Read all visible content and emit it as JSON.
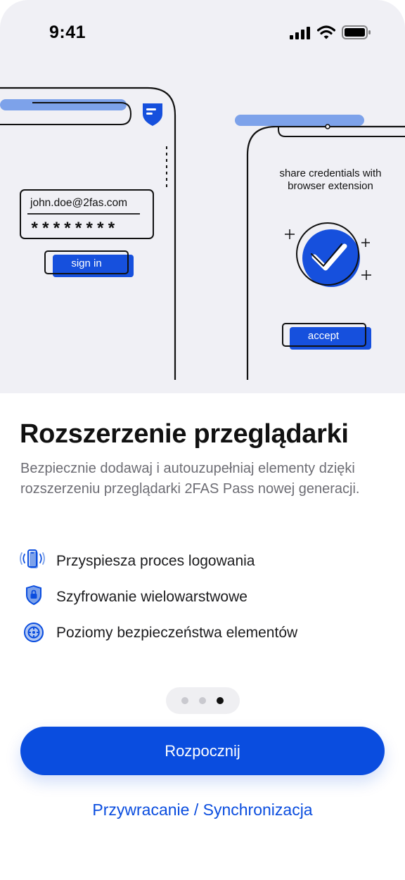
{
  "status_bar": {
    "time": "9:41"
  },
  "illustration": {
    "left_phone": {
      "email": "john.doe@2fas.com",
      "password_mask": "********",
      "button_label": "sign in"
    },
    "right_phone": {
      "caption_line1": "share credentials with",
      "caption_line2": "browser extension",
      "button_label": "accept"
    }
  },
  "content": {
    "title": "Rozszerzenie przeglądarki",
    "description": "Bezpiecznie dodawaj i autouzupełniaj elementy dzięki rozszerzeniu przeglądarki 2FAS Pass nowej generacji.",
    "features": [
      {
        "icon": "phone-vibrate-icon",
        "label": "Przyspiesza proces logowania"
      },
      {
        "icon": "shield-lock-icon",
        "label": "Szyfrowanie wielowarstwowe"
      },
      {
        "icon": "security-levels-icon",
        "label": "Poziomy bezpieczeństwa elementów"
      }
    ]
  },
  "pager": {
    "total": 3,
    "current": 3
  },
  "actions": {
    "primary_label": "Rozpocznij",
    "secondary_label": "Przywracanie / Synchronizacja"
  },
  "colors": {
    "accent": "#0a4ddf",
    "highlight": "#7da2ea",
    "background_top": "#f0f0f5"
  }
}
